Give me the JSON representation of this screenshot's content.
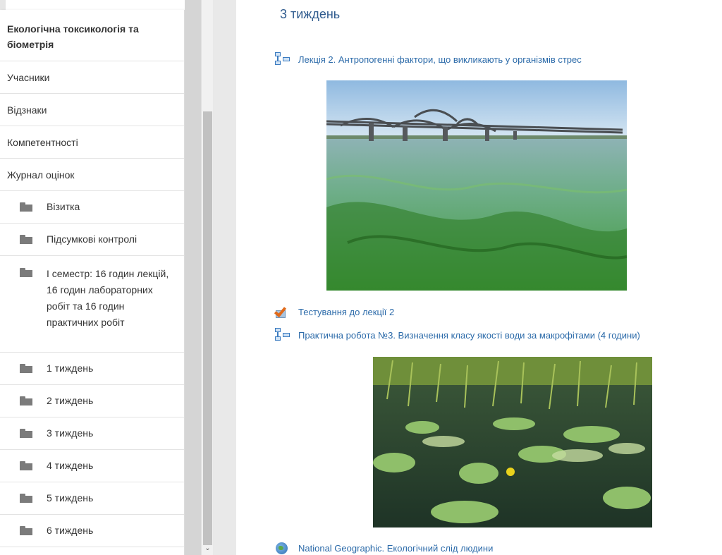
{
  "drawer": {
    "course_title": "Екологічна токсикологія та біометрія",
    "nav_items": [
      "Учасники",
      "Відзнаки",
      "Компетентності",
      "Журнал оцінок"
    ],
    "folders": [
      "Візитка",
      "Підсумкові контролі",
      "І семестр: 16 годин лекцій, 16 годин лабораторних робіт та 16 годин практичних робіт",
      "1 тиждень",
      "2 тиждень",
      "3 тиждень",
      "4 тиждень",
      "5 тиждень",
      "6 тиждень"
    ]
  },
  "main": {
    "section_title": "3 тиждень",
    "activities": [
      {
        "label": "Лекція 2. Антропогенні фактори, що викликають у організмів стрес",
        "icon": "lesson-icon"
      },
      {
        "label": "Тестування до лекції 2",
        "icon": "quiz-icon"
      },
      {
        "label": "Практична робота №3. Визначення класу якості води за макрофітами (4 години)",
        "icon": "lesson-icon"
      },
      {
        "label": "National Geographic. Екологічний слід людини",
        "icon": "url-icon"
      }
    ]
  },
  "colors": {
    "link": "#2b6aa9",
    "section_title": "#2f5b8e",
    "folder_icon": "#7b7b7b"
  }
}
